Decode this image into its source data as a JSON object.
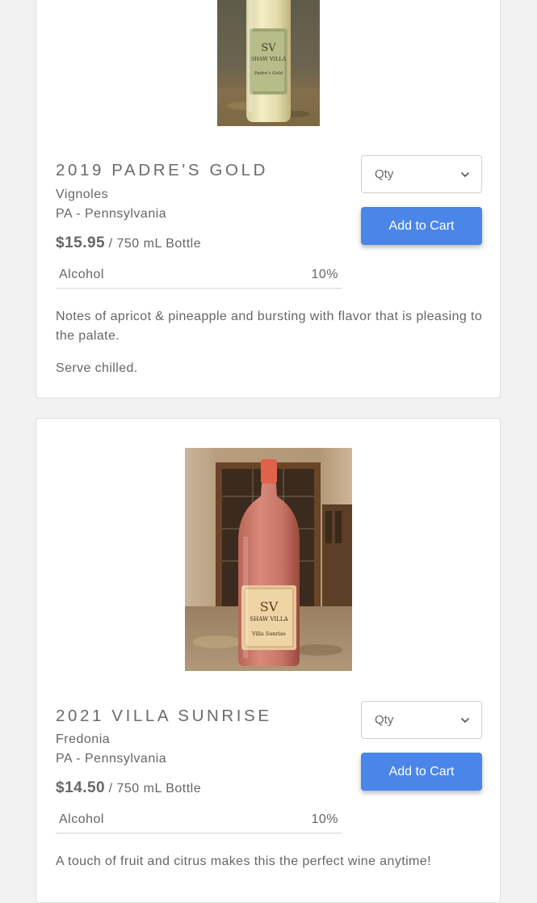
{
  "products": [
    {
      "name": "2019 PADRE'S GOLD",
      "varietal": "Vignoles",
      "region": "PA - Pennsylvania",
      "price": "$15.95",
      "unit": "/ 750 mL Bottle",
      "spec_label": "Alcohol",
      "spec_value": "10%",
      "qty_placeholder": "Qty",
      "add_to_cart_label": "Add to Cart",
      "description": "Notes of apricot & pineapple and bursting with flavor that is pleasing to the palate.",
      "serving": "Serve chilled.",
      "label_brand": "SHAW VILLA",
      "label_name": "Padre's Gold",
      "wine_color": "#e9e0b0"
    },
    {
      "name": "2021 VILLA SUNRISE",
      "varietal": "Fredonia",
      "region": "PA - Pennsylvania",
      "price": "$14.50",
      "unit": "/ 750 mL Bottle",
      "spec_label": "Alcohol",
      "spec_value": "10%",
      "qty_placeholder": "Qty",
      "add_to_cart_label": "Add to Cart",
      "description": "A touch of fruit and citrus makes this the perfect wine anytime!",
      "label_brand": "SHAW VILLA",
      "label_name": "Villa Sunrise",
      "wine_color": "#c97566"
    }
  ],
  "colors": {
    "button": "#4a86e8",
    "page_background": "#f2f2f2",
    "card_background": "#ffffff"
  }
}
